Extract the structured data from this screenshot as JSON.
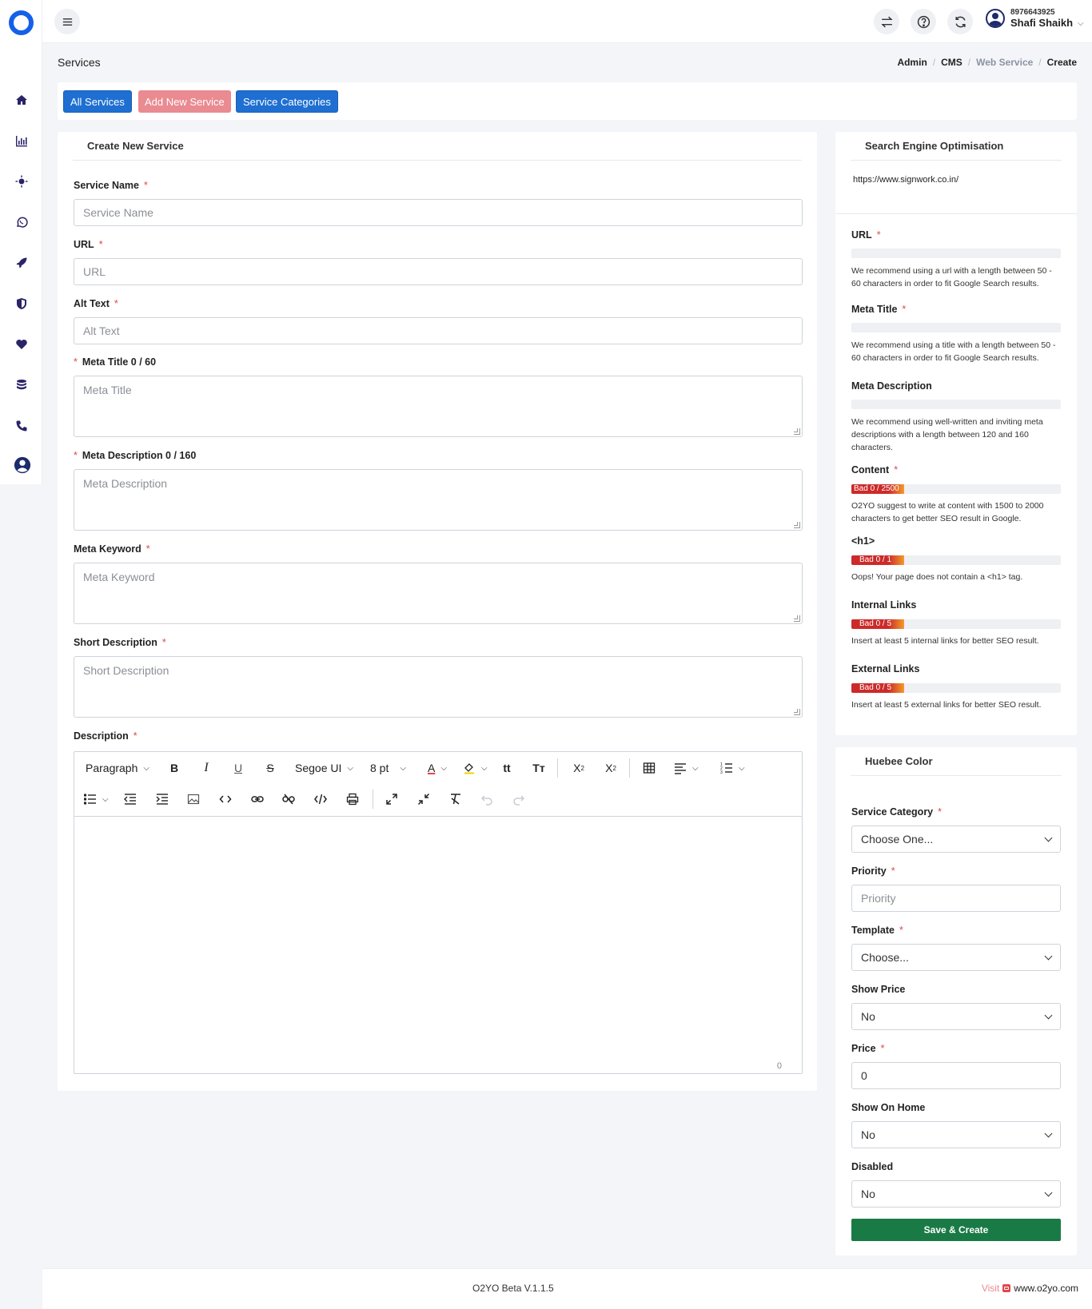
{
  "user": {
    "phone": "8976643925",
    "name": "Shafi Shaikh"
  },
  "page": {
    "title": "Services"
  },
  "breadcrumb": [
    "Admin",
    "CMS",
    "Web Service",
    "Create"
  ],
  "tabs": {
    "all_services": "All Services",
    "add_new": "Add New Service",
    "categories": "Service Categories"
  },
  "form": {
    "title": "Create New Service",
    "service_name": {
      "label": "Service Name",
      "placeholder": "Service Name"
    },
    "url": {
      "label": "URL",
      "placeholder": "URL"
    },
    "alt_text": {
      "label": "Alt Text",
      "placeholder": "Alt Text"
    },
    "meta_title": {
      "label": "Meta Title 0 / 60",
      "placeholder": "Meta Title"
    },
    "meta_description": {
      "label": "Meta Description 0 / 160",
      "placeholder": "Meta Description"
    },
    "meta_keyword": {
      "label": "Meta Keyword",
      "placeholder": "Meta Keyword"
    },
    "short_description": {
      "label": "Short Description",
      "placeholder": "Short Description"
    },
    "description": {
      "label": "Description"
    }
  },
  "editor": {
    "block_format": "Paragraph",
    "font_family": "Segoe UI",
    "font_size": "8 pt",
    "word_count": "0"
  },
  "seo": {
    "title": "Search Engine Optimisation",
    "site_url": "https://www.signwork.co.in/",
    "url": {
      "label": "URL",
      "help": "We recommend using a url with a length between 50 - 60 characters in order to fit Google Search results."
    },
    "meta_title": {
      "label": "Meta Title",
      "help": "We recommend using a title with a length between 50 - 60 characters in order to fit Google Search results."
    },
    "meta_description": {
      "label": "Meta Description",
      "help": "We recommend using well-written and inviting meta descriptions with a length between 120 and 160 characters."
    },
    "content": {
      "label": "Content",
      "badge": "Bad 0 / 2500",
      "help": "O2YO suggest to write at content with 1500 to 2000 characters to get better SEO result in Google."
    },
    "h1": {
      "label": "<h1>",
      "badge": "Bad 0 / 1",
      "help": "Oops! Your page does not contain a <h1> tag."
    },
    "internal_links": {
      "label": "Internal Links",
      "badge": "Bad 0 / 5",
      "help": "Insert at least 5 internal links for better SEO result."
    },
    "external_links": {
      "label": "External Links",
      "badge": "Bad 0 / 5",
      "help": "Insert at least 5 external links for better SEO result."
    }
  },
  "huebee": {
    "title": "Huebee Color",
    "service_category": {
      "label": "Service Category",
      "value": "Choose One..."
    },
    "priority": {
      "label": "Priority",
      "placeholder": "Priority"
    },
    "template": {
      "label": "Template",
      "value": "Choose..."
    },
    "show_price": {
      "label": "Show Price",
      "value": "No"
    },
    "price": {
      "label": "Price",
      "value": "0"
    },
    "show_on_home": {
      "label": "Show On Home",
      "value": "No"
    },
    "disabled": {
      "label": "Disabled",
      "value": "No"
    },
    "save_label": "Save & Create"
  },
  "footer": {
    "version": "O2YO Beta V.1.1.5",
    "visit_label": "Visit",
    "site": "www.o2yo.com"
  },
  "colors": {
    "primary": "#1e6fd1",
    "accent_pink": "#ea8a91",
    "success": "#1a7a45",
    "danger": "#cc2a2a",
    "sidebar_icon": "#2a2468"
  }
}
